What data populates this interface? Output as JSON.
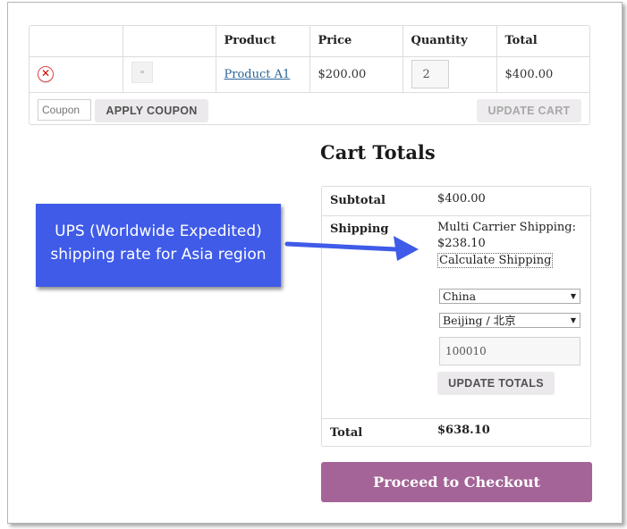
{
  "cart_table": {
    "headers": [
      "",
      "",
      "Product",
      "Price",
      "Quantity",
      "Total"
    ],
    "row": {
      "remove_symbol": "✕",
      "product": "Product A1",
      "price": "$200.00",
      "quantity": "2",
      "total": "$400.00"
    },
    "coupon_placeholder": "Coupon",
    "apply_coupon_label": "APPLY COUPON",
    "update_cart_label": "UPDATE CART"
  },
  "cart_totals": {
    "title": "Cart Totals",
    "subtotal_label": "Subtotal",
    "subtotal_value": "$400.00",
    "shipping_label": "Shipping",
    "shipping_method": "Multi Carrier Shipping:",
    "shipping_price": "$238.10",
    "calculate_shipping": "Calculate Shipping",
    "country": "China",
    "state": "Beijing / 北京",
    "postcode": "100010",
    "update_totals_label": "UPDATE TOTALS",
    "total_label": "Total",
    "total_value": "$638.10"
  },
  "checkout_label": "Proceed to Checkout",
  "callout": {
    "line1": "UPS (Worldwide Expedited)",
    "line2": "shipping rate for Asia region"
  },
  "colors": {
    "checkout": "#a46497",
    "callout": "#3f5be8",
    "link": "#2a6496"
  },
  "icons": [
    "remove-icon",
    "product-thumbnail",
    "chevron-down-icon",
    "arrow-right-icon"
  ]
}
